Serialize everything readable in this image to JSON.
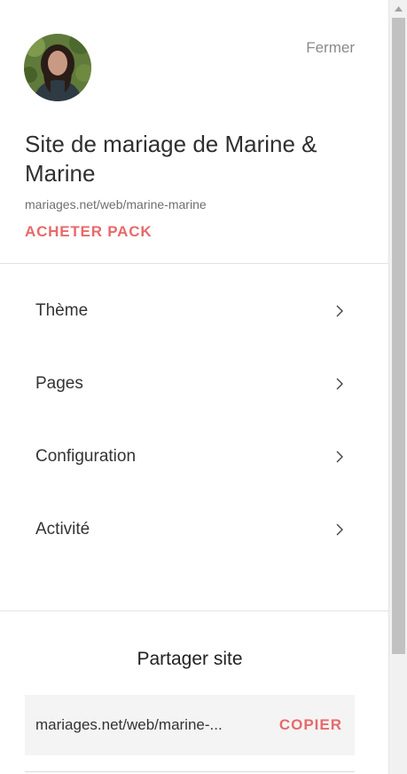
{
  "header": {
    "close_label": "Fermer",
    "avatar_alt": "avatar"
  },
  "site": {
    "title": "Site de mariage de Marine & Marine",
    "url": "mariages.net/web/marine-marine",
    "buy_label": "ACHETER PACK"
  },
  "menu": {
    "items": [
      {
        "label": "Thème",
        "icon": "chevron-right-icon"
      },
      {
        "label": "Pages",
        "icon": "chevron-right-icon"
      },
      {
        "label": "Configuration",
        "icon": "chevron-right-icon"
      },
      {
        "label": "Activité",
        "icon": "chevron-right-icon"
      }
    ]
  },
  "share": {
    "title": "Partager site",
    "url_display": "mariages.net/web/marine-...",
    "copy_label": "COPIER"
  },
  "colors": {
    "accent": "#e8696b",
    "text": "#333333",
    "muted": "#8a8a8a"
  }
}
